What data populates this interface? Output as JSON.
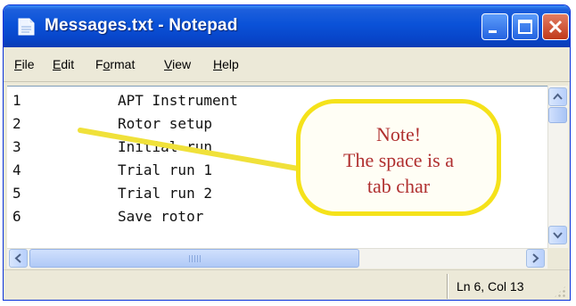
{
  "window": {
    "title": "Messages.txt - Notepad"
  },
  "menu": [
    {
      "key": "F",
      "rest": "ile"
    },
    {
      "key": "E",
      "rest": "dit"
    },
    {
      "key": "o",
      "pre": "F",
      "rest": "rmat"
    },
    {
      "key": "V",
      "rest": "iew"
    },
    {
      "key": "H",
      "rest": "elp"
    }
  ],
  "lines": [
    {
      "num": "1",
      "text": "APT Instrument"
    },
    {
      "num": "2",
      "text": "Rotor setup"
    },
    {
      "num": "3",
      "text": "Initial run"
    },
    {
      "num": "4",
      "text": "Trial run 1"
    },
    {
      "num": "5",
      "text": "Trial run 2"
    },
    {
      "num": "6",
      "text": "Save rotor"
    }
  ],
  "status": {
    "position": "Ln 6, Col 13"
  },
  "annotation": {
    "line1": "Note!",
    "line2": "The space is a",
    "line3": "tab char"
  },
  "colors": {
    "titlebar": "#0a52d8",
    "callout_border": "#f5e21a",
    "callout_text": "#b03030"
  },
  "icons": {
    "app": "notepad-icon",
    "minimize": "minimize-icon",
    "maximize": "maximize-icon",
    "close": "close-icon"
  }
}
